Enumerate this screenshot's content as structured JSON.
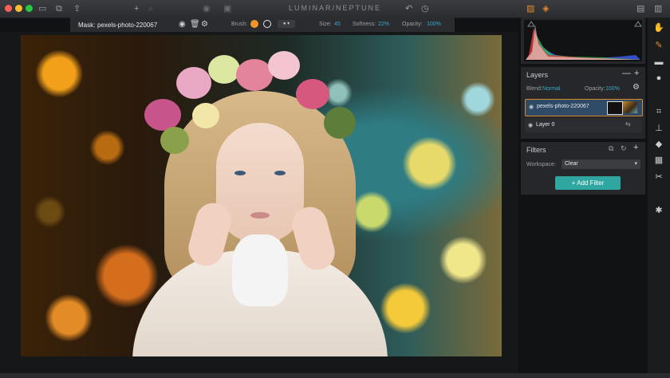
{
  "app": {
    "title": "LUMINAR/NEPTUNE"
  },
  "toolbar": {
    "mask_label": "Mask:",
    "mask_name": "pexels-photo-220067",
    "brush_label": "Brush:",
    "size_label": "Size:",
    "size_value": "45",
    "softness_label": "Softness:",
    "softness_value": "22%",
    "opacity_label": "Opacity:",
    "opacity_value": "100%"
  },
  "layers": {
    "title": "Layers",
    "blend_label": "Blend:",
    "blend_value": "Normal",
    "opacity_label": "Opacity:",
    "opacity_value": "100%",
    "items": [
      {
        "name": "pexels-photo-220067"
      },
      {
        "name": "Layer 0"
      }
    ]
  },
  "filters": {
    "title": "Filters",
    "workspace_label": "Workspace:",
    "workspace_value": "Clear",
    "add_button": "Add Filter"
  },
  "colors": {
    "accent": "#2fa7a0",
    "highlight": "#3aa9c9"
  }
}
